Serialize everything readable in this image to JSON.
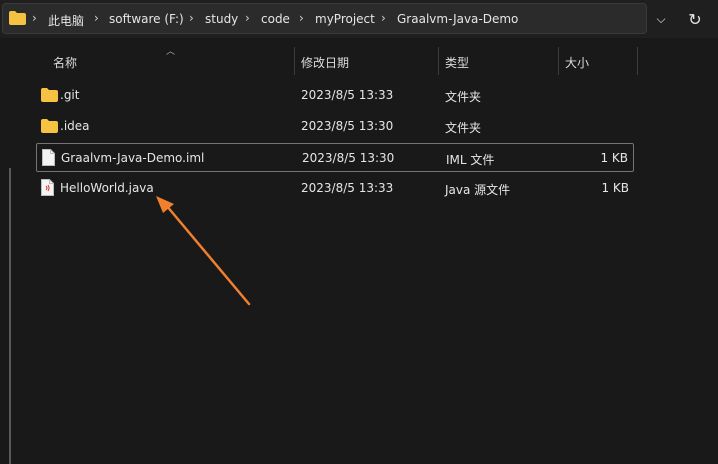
{
  "breadcrumb": {
    "items": [
      "此电脑",
      "software (F:)",
      "study",
      "code",
      "myProject",
      "Graalvm-Java-Demo"
    ]
  },
  "columns": {
    "name": "名称",
    "date": "修改日期",
    "type": "类型",
    "size": "大小"
  },
  "files": [
    {
      "name": ".git",
      "date": "2023/8/5 13:33",
      "type": "文件夹",
      "size": "",
      "icon": "folder-icon"
    },
    {
      "name": ".idea",
      "date": "2023/8/5 13:30",
      "type": "文件夹",
      "size": "",
      "icon": "folder-icon"
    },
    {
      "name": "Graalvm-Java-Demo.iml",
      "date": "2023/8/5 13:30",
      "type": "IML 文件",
      "size": "1 KB",
      "icon": "file-icon"
    },
    {
      "name": "HelloWorld.java",
      "date": "2023/8/5 13:33",
      "type": "Java 源文件",
      "size": "1 KB",
      "icon": "java-file-icon"
    }
  ],
  "colors": {
    "background": "#191919",
    "folder": "#f5c242",
    "annotation_arrow": "#f07f2e"
  }
}
